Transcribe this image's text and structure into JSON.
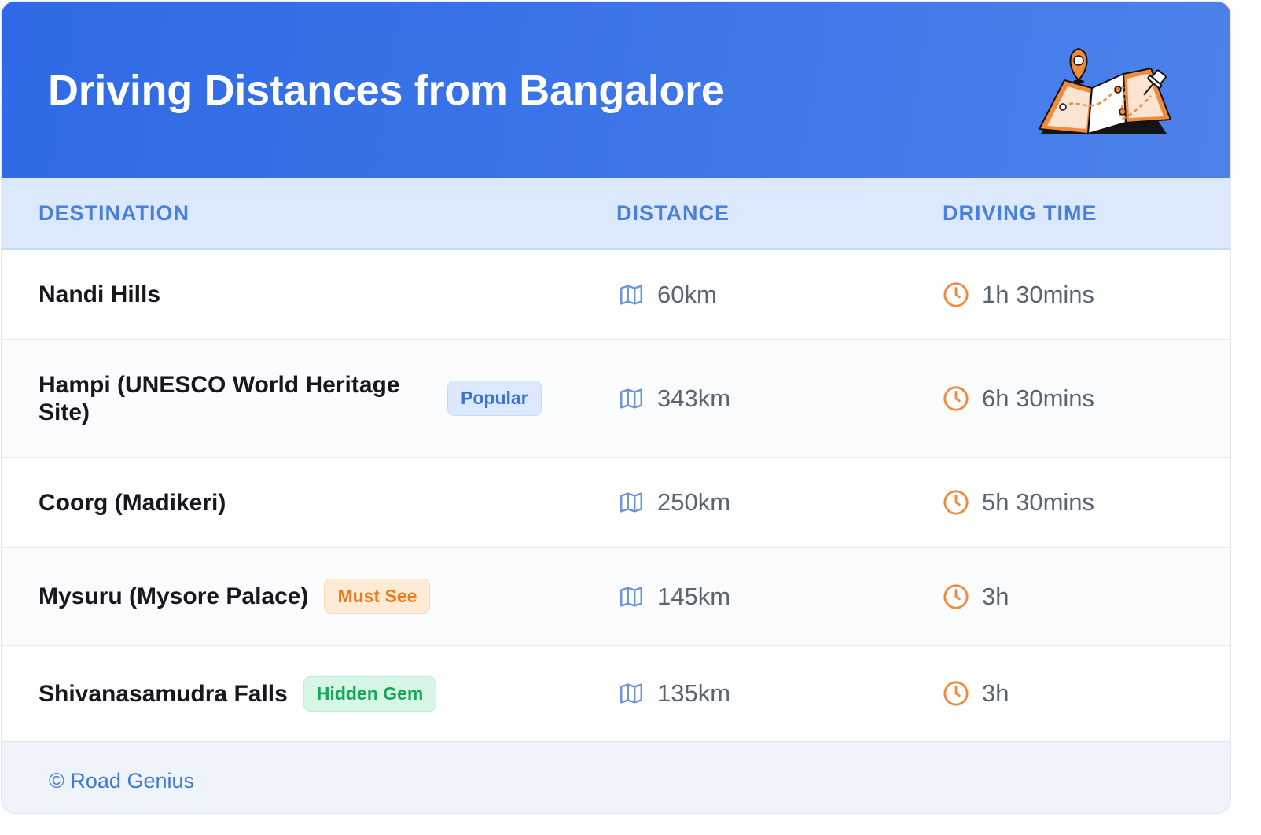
{
  "header": {
    "title": "Driving Distances from Bangalore"
  },
  "columns": {
    "destination": "DESTINATION",
    "distance": "DISTANCE",
    "driving_time": "DRIVING TIME"
  },
  "rows": [
    {
      "destination": "Nandi Hills",
      "badge": "",
      "distance": "60km",
      "time": "1h 30mins"
    },
    {
      "destination": "Hampi (UNESCO World Heritage Site)",
      "badge": "Popular",
      "badge_color": "#3a72d6",
      "distance": "343km",
      "time": "6h 30mins"
    },
    {
      "destination": "Coorg (Madikeri)",
      "badge": "",
      "distance": "250km",
      "time": "5h 30mins"
    },
    {
      "destination": "Mysuru (Mysore Palace)",
      "badge": "Must See",
      "badge_color": "#ee7a1a",
      "distance": "145km",
      "time": "3h"
    },
    {
      "destination": "Shivanasamudra Falls",
      "badge": "Hidden Gem",
      "badge_color": "#14a85a",
      "distance": "135km",
      "time": "3h"
    }
  ],
  "icons": {
    "header": "map-pin-illustration",
    "distance": "map-icon",
    "time": "clock-icon"
  },
  "footer": {
    "text": "© Road Genius"
  },
  "colors": {
    "header_bg": "#2f6ae6",
    "accent": "#4a7fdc",
    "clock": "#f08a3c"
  }
}
